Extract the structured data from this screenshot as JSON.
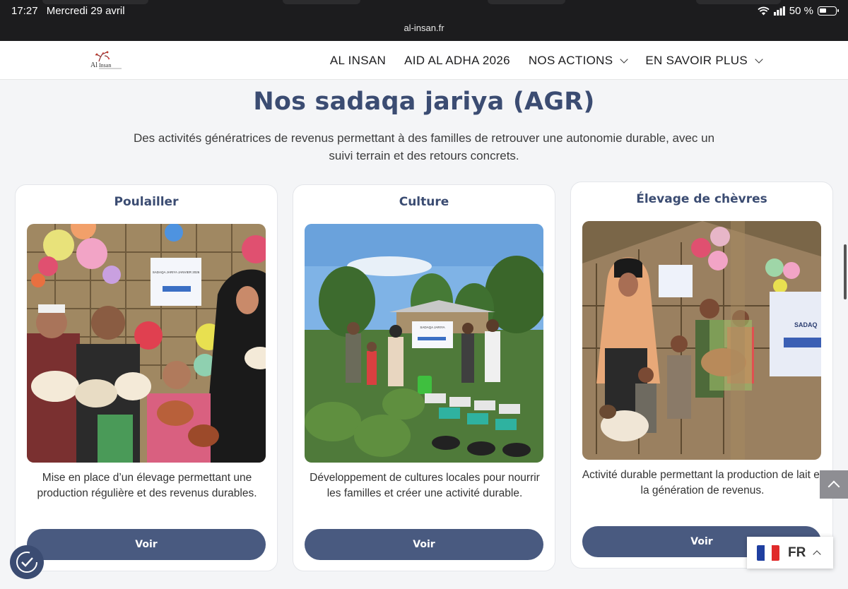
{
  "status_bar": {
    "time": "17:27",
    "date": "Mercredi 29 avril",
    "battery": "50 %",
    "url": "al-insan.fr"
  },
  "header": {
    "logo_text": "Al Insan",
    "nav": [
      {
        "label": "AL INSAN"
      },
      {
        "label": "AID AL ADHA 2026"
      },
      {
        "label": "NOS ACTIONS"
      },
      {
        "label": "EN SAVOIR PLUS"
      }
    ]
  },
  "section": {
    "title": "Nos sadaqa jariya (AGR)",
    "subtitle": "Des activités génératrices de revenus permettant à des familles de retrouver une autonomie durable, avec un suivi terrain et des retours concrets."
  },
  "cards": [
    {
      "title": "Poulailler",
      "description": "Mise en place d’un élevage permettant une production régulière et des revenus durables.",
      "button": "Voir",
      "sign_text": "SADAQA JARIYA JANVIER 2026"
    },
    {
      "title": "Culture",
      "description": "Développement de cultures locales pour nourrir les familles et créer une activité durable.",
      "button": "Voir",
      "sign_text": "SADAQA JARIYA"
    },
    {
      "title": "Élevage de chèvres",
      "description": "Activité durable permettant la production de lait et la génération de revenus.",
      "button": "Voir",
      "sign_text": "SADAQ"
    }
  ],
  "language_switcher": {
    "code": "FR"
  },
  "icons": {
    "wifi": "wifi-icon",
    "signal": "signal-icon",
    "battery": "battery-icon",
    "chevron": "chevron-down-icon",
    "scroll_top": "chevron-up-icon",
    "accessibility": "accessibility-icon",
    "flag": "france-flag-icon"
  },
  "colors": {
    "brand": "#3b4c72",
    "button": "#495a80",
    "status_bg": "#1c1c1e"
  }
}
